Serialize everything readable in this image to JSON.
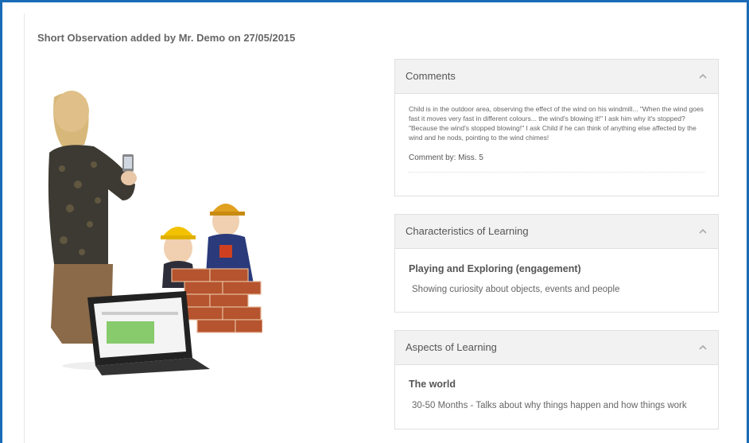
{
  "observation": {
    "title": "Short Observation added by Mr. Demo on 27/05/2015"
  },
  "panels": {
    "comments": {
      "title": "Comments",
      "text": "Child is in the outdoor area, observing the effect of the wind on his windmill... \"When the wind goes fast it moves very fast in different colours... the wind's blowing it!\" I ask him why it's stopped? \"Because the wind's stopped blowing!\" I ask Child if he can think of anything else affected by the wind and he nods, pointing to the wind chimes!",
      "comment_by": "Comment by: Miss. 5"
    },
    "characteristics": {
      "title": "Characteristics of Learning",
      "subheading": "Playing and Exploring (engagement)",
      "detail": "Showing curiosity about objects, events and people"
    },
    "aspects": {
      "title": "Aspects of Learning",
      "subheading": "The world",
      "detail": "30-50 Months - Talks about why things happen and how things work"
    }
  },
  "colors": {
    "frame_border": "#1a6bb5",
    "panel_header_bg": "#f2f2f2",
    "panel_border": "#e0e0e0",
    "text": "#555555"
  },
  "icons": {
    "collapse": "chevron-up-icon"
  }
}
